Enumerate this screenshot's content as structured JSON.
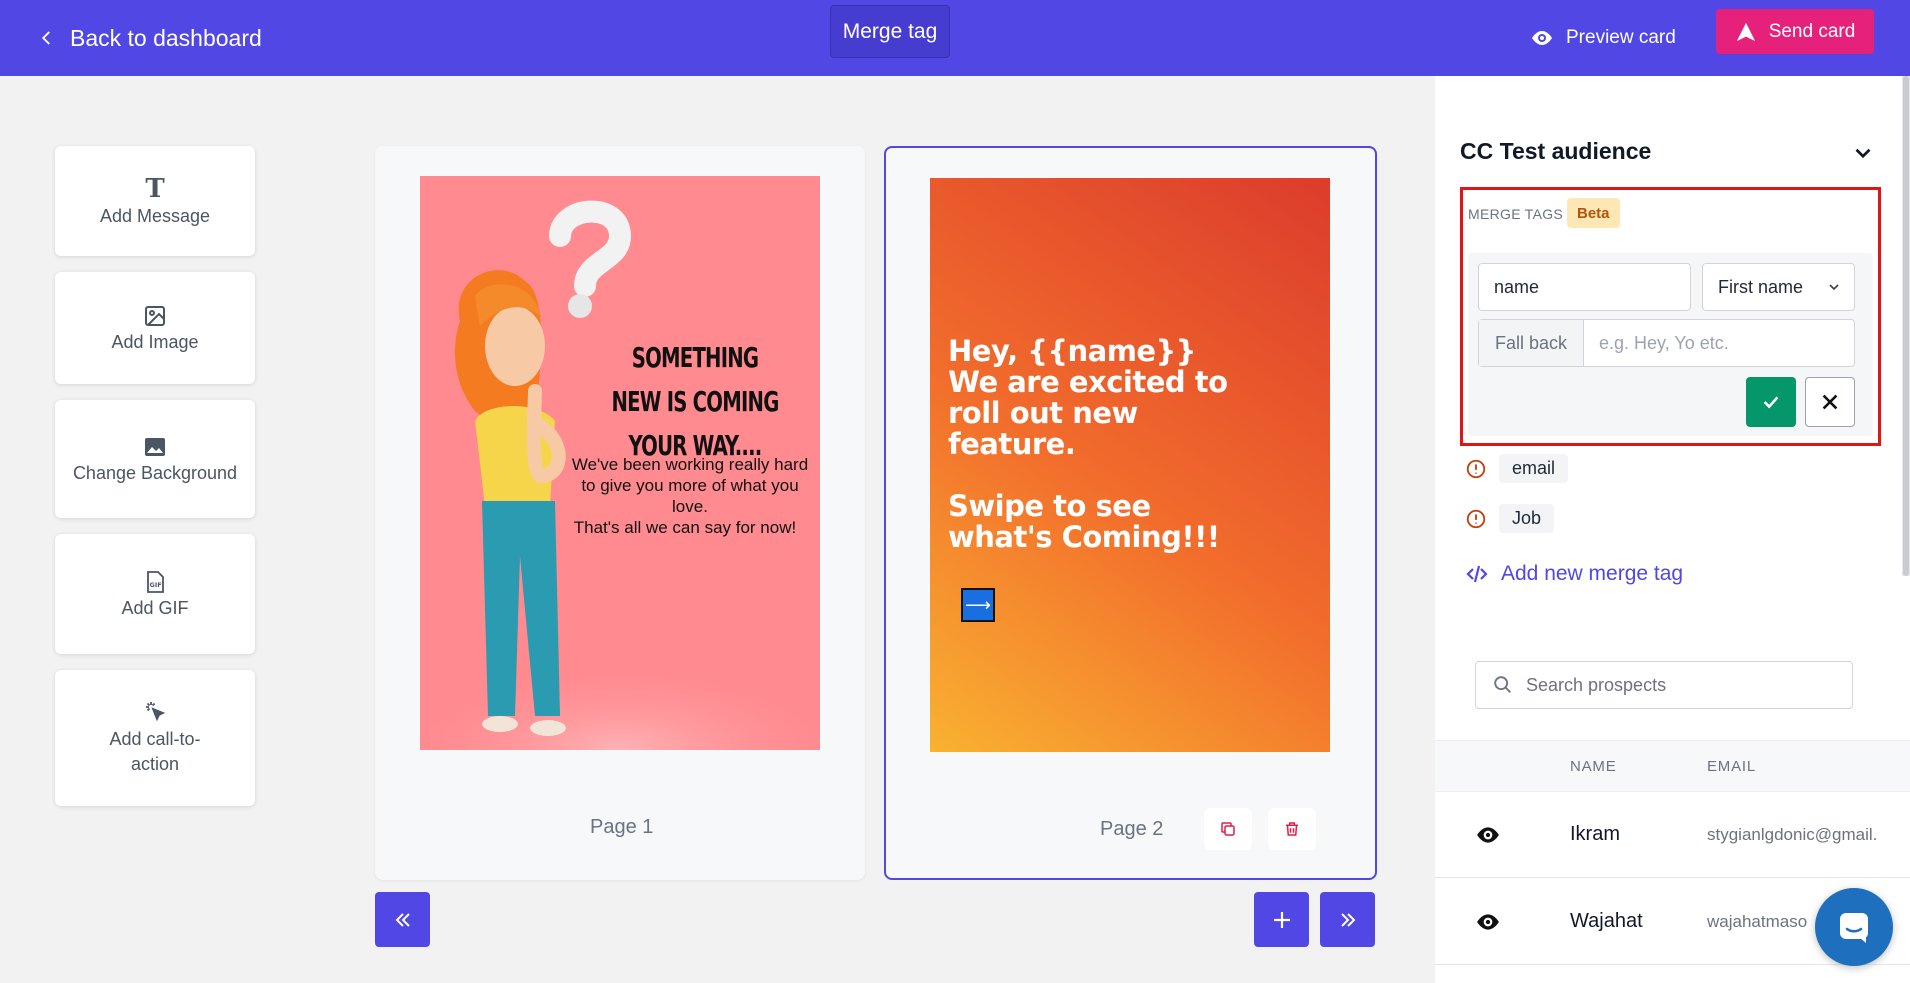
{
  "topbar": {
    "back_label": "Back to dashboard",
    "merge_tag_label": "Merge tag",
    "preview_label": "Preview card",
    "send_label": "Send card"
  },
  "tools": [
    {
      "label": "Add Message",
      "icon": "text-icon"
    },
    {
      "label": "Add Image",
      "icon": "image-icon"
    },
    {
      "label": "Change Background",
      "icon": "background-image-icon"
    },
    {
      "label": "Add GIF",
      "icon": "gif-icon"
    },
    {
      "label": "Add call-to-action",
      "icon": "cursor-click-icon"
    }
  ],
  "pages": [
    {
      "label": "Page 1",
      "title": "SOMETHING NEW IS COMING YOUR WAY....",
      "body": "We've been working really hard to give you more of what you love.",
      "body_last": "That's all we can say for now!"
    },
    {
      "label": "Page 2",
      "line1": "Hey, {{name}}",
      "line2": "We are excited to",
      "line3": "roll out new",
      "line4": "feature.",
      "line5": "Swipe to see",
      "line6": "what's Coming!!!",
      "arrow": "⟶"
    }
  ],
  "panel": {
    "audience_title": "CC Test audience",
    "merge_tags_label": "MERGE TAGS",
    "beta_label": "Beta",
    "tag_name_value": "name",
    "field_select_value": "First name",
    "fallback_addon": "Fall back",
    "fallback_placeholder": "e.g. Hey, Yo etc.",
    "tags": [
      "email",
      "Job"
    ],
    "add_tag_label": "Add new merge tag",
    "search_placeholder": "Search prospects",
    "columns": {
      "name": "NAME",
      "email": "EMAIL"
    },
    "rows": [
      {
        "name": "Ikram",
        "email": "stygianlgdonic@gmail."
      },
      {
        "name": "Wajahat",
        "email": "wajahatmaso"
      }
    ]
  },
  "colors": {
    "brand": "#5147e5",
    "send": "#e6217c",
    "confirm": "#059669",
    "highlight": "#e01616"
  }
}
